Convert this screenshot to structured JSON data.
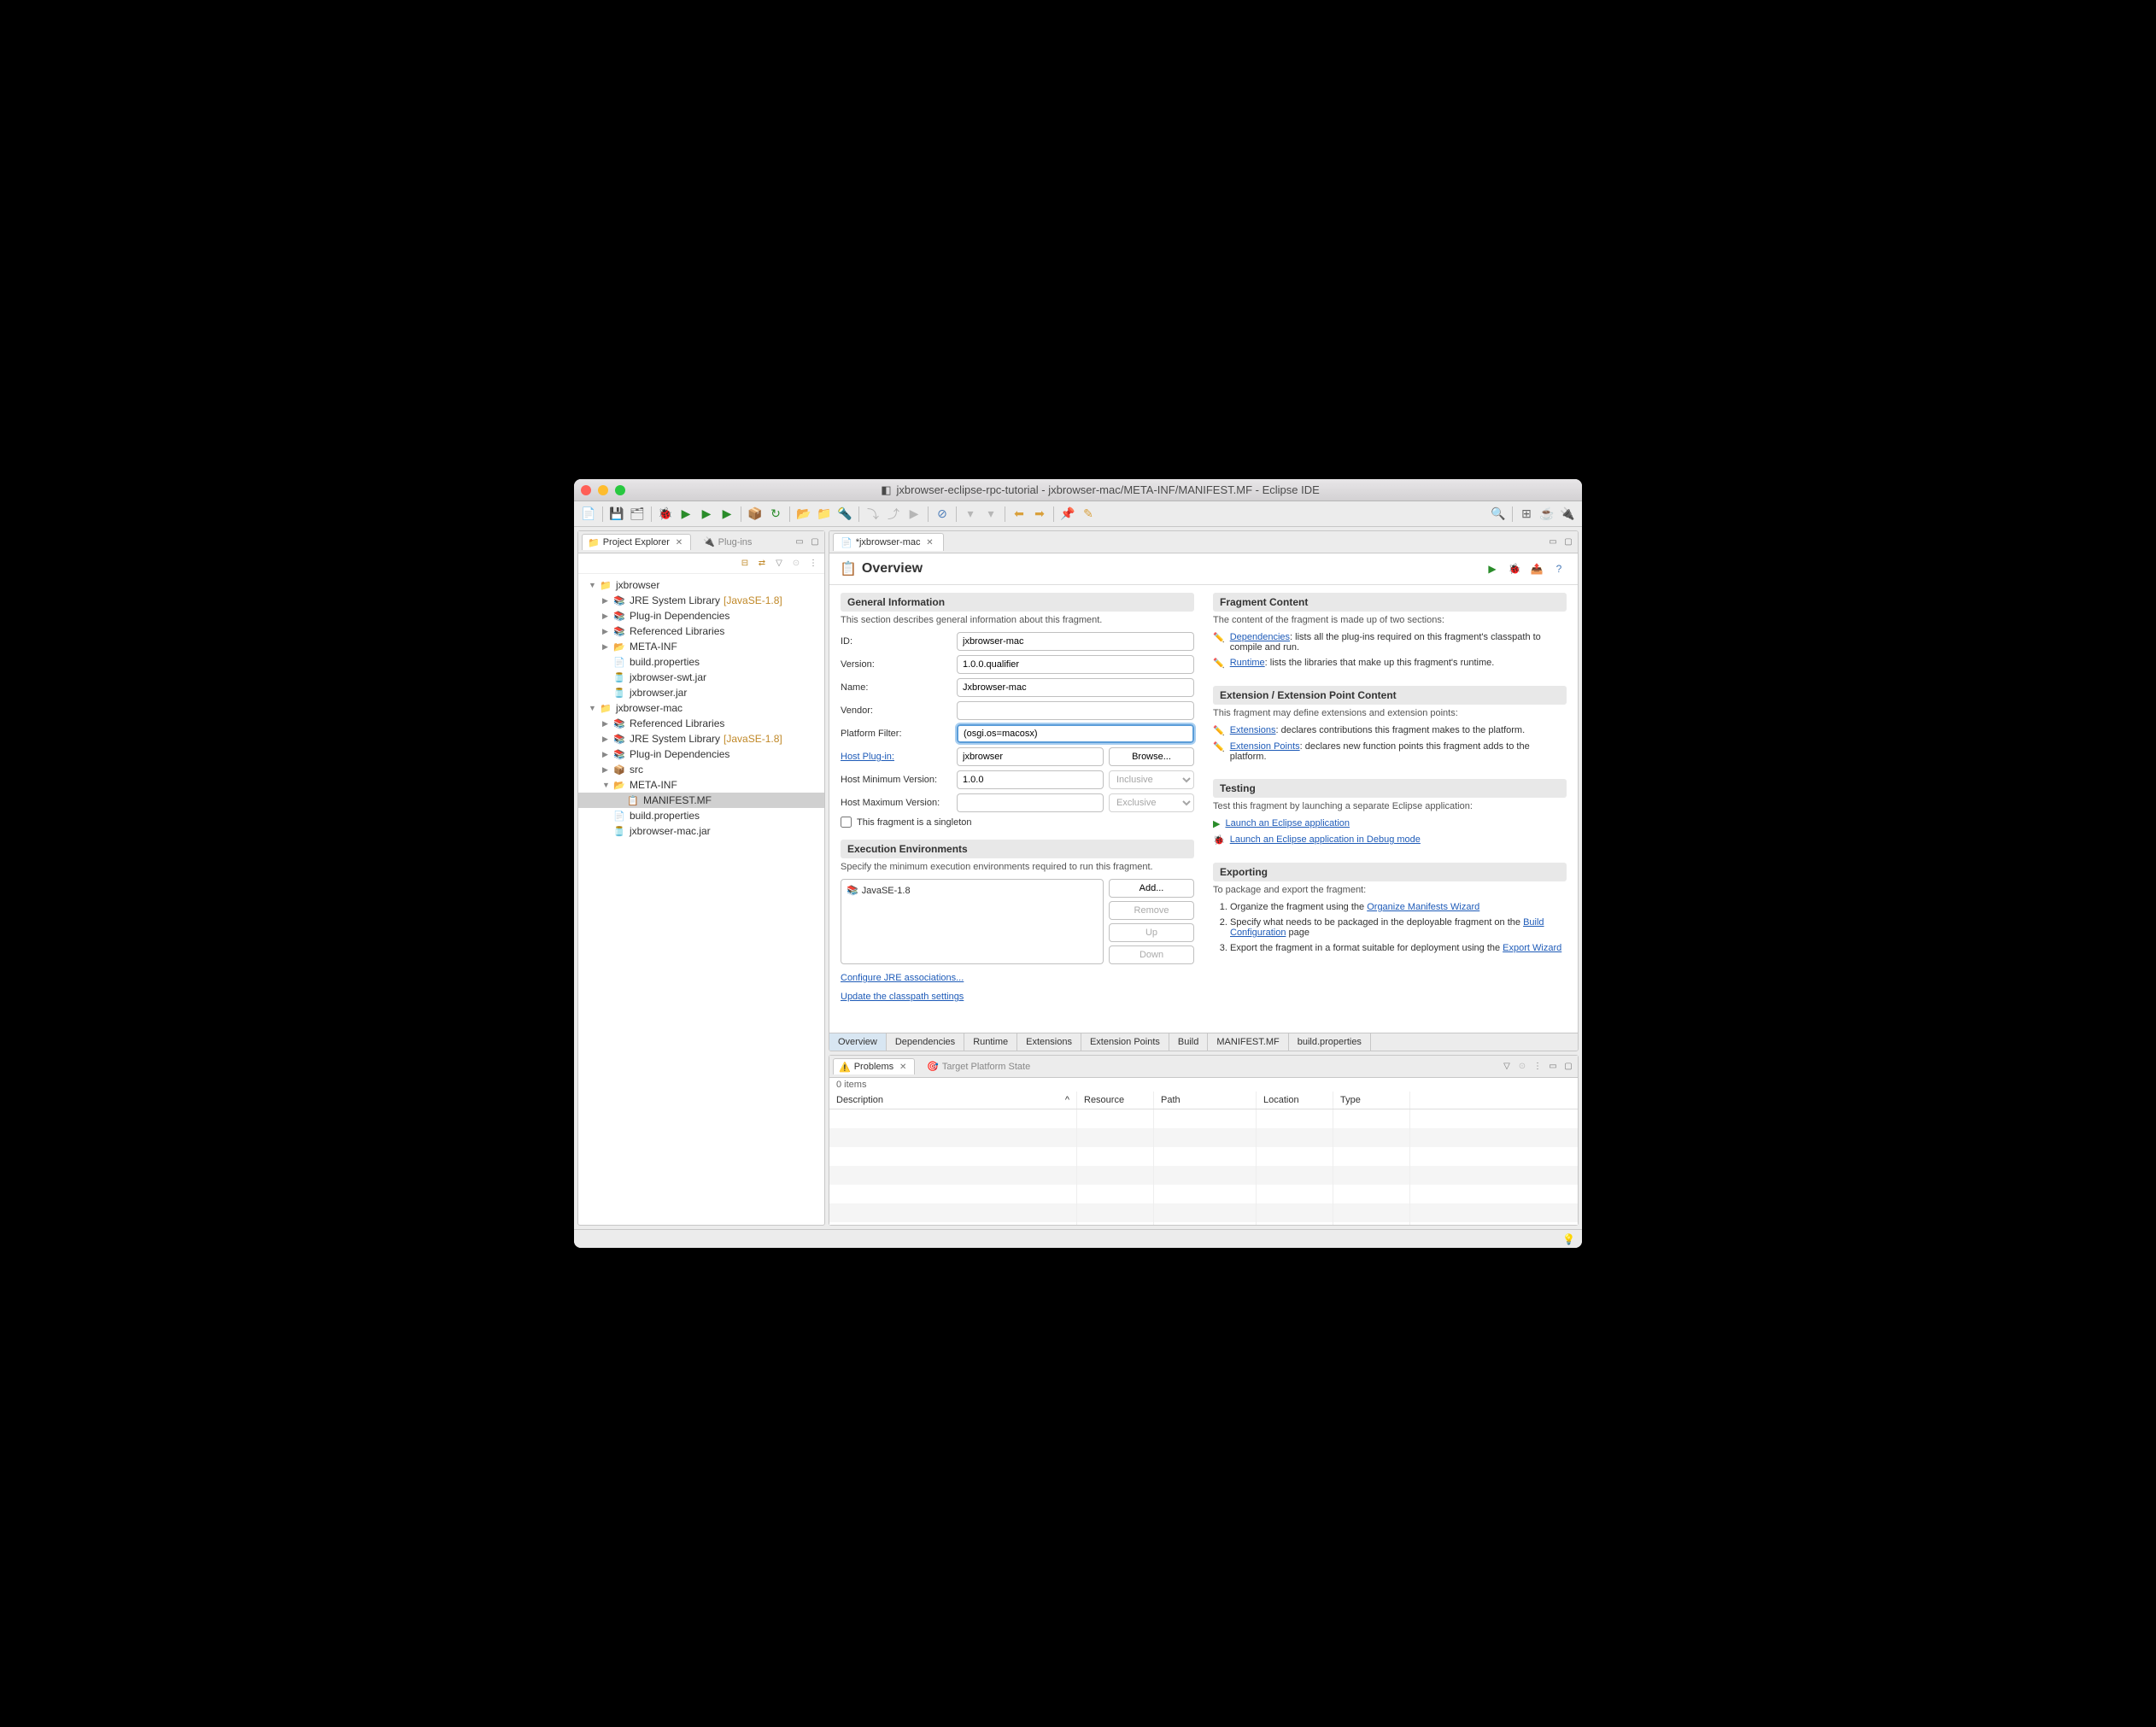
{
  "window": {
    "title": "jxbrowser-eclipse-rpc-tutorial - jxbrowser-mac/META-INF/MANIFEST.MF - Eclipse IDE"
  },
  "leftPanel": {
    "tabs": {
      "projectExplorer": "Project Explorer",
      "plugins": "Plug-ins"
    }
  },
  "tree": {
    "items": [
      {
        "label": "jxbrowser",
        "indent": 0,
        "arrow": "▼",
        "icon": "project"
      },
      {
        "label": "JRE System Library",
        "decoration": "[JavaSE-1.8]",
        "indent": 1,
        "arrow": "▶",
        "icon": "library"
      },
      {
        "label": "Plug-in Dependencies",
        "indent": 1,
        "arrow": "▶",
        "icon": "library"
      },
      {
        "label": "Referenced Libraries",
        "indent": 1,
        "arrow": "▶",
        "icon": "library"
      },
      {
        "label": "META-INF",
        "indent": 1,
        "arrow": "▶",
        "icon": "folder"
      },
      {
        "label": "build.properties",
        "indent": 1,
        "arrow": "",
        "icon": "props"
      },
      {
        "label": "jxbrowser-swt.jar",
        "indent": 1,
        "arrow": "",
        "icon": "jar"
      },
      {
        "label": "jxbrowser.jar",
        "indent": 1,
        "arrow": "",
        "icon": "jar"
      },
      {
        "label": "jxbrowser-mac",
        "indent": 0,
        "arrow": "▼",
        "icon": "project"
      },
      {
        "label": "Referenced Libraries",
        "indent": 1,
        "arrow": "▶",
        "icon": "library"
      },
      {
        "label": "JRE System Library",
        "decoration": "[JavaSE-1.8]",
        "indent": 1,
        "arrow": "▶",
        "icon": "library"
      },
      {
        "label": "Plug-in Dependencies",
        "indent": 1,
        "arrow": "▶",
        "icon": "library"
      },
      {
        "label": "src",
        "indent": 1,
        "arrow": "▶",
        "icon": "src"
      },
      {
        "label": "META-INF",
        "indent": 1,
        "arrow": "▼",
        "icon": "folder"
      },
      {
        "label": "MANIFEST.MF",
        "indent": 2,
        "arrow": "",
        "icon": "manifest",
        "selected": true
      },
      {
        "label": "build.properties",
        "indent": 1,
        "arrow": "",
        "icon": "props"
      },
      {
        "label": "jxbrowser-mac.jar",
        "indent": 1,
        "arrow": "",
        "icon": "jar"
      }
    ]
  },
  "editor": {
    "tabLabel": "*jxbrowser-mac",
    "title": "Overview"
  },
  "general": {
    "header": "General Information",
    "desc": "This section describes general information about this fragment.",
    "labels": {
      "id": "ID:",
      "version": "Version:",
      "name": "Name:",
      "vendor": "Vendor:",
      "platformFilter": "Platform Filter:",
      "hostPlugin": "Host Plug-in:",
      "hostMin": "Host Minimum Version:",
      "hostMax": "Host Maximum Version:"
    },
    "values": {
      "id": "jxbrowser-mac",
      "version": "1.0.0.qualifier",
      "name": "Jxbrowser-mac",
      "vendor": "",
      "platformFilter": "(osgi.os=macosx)",
      "hostPlugin": "jxbrowser",
      "hostMin": "1.0.0",
      "hostMax": ""
    },
    "browse": "Browse...",
    "inclusive": "Inclusive",
    "exclusive": "Exclusive",
    "singleton": "This fragment is a singleton"
  },
  "exec": {
    "header": "Execution Environments",
    "desc": "Specify the minimum execution environments required to run this fragment.",
    "item": "JavaSE-1.8",
    "buttons": {
      "add": "Add...",
      "remove": "Remove",
      "up": "Up",
      "down": "Down"
    },
    "links": {
      "configure": "Configure JRE associations...",
      "update": "Update the classpath settings"
    }
  },
  "fragmentContent": {
    "header": "Fragment Content",
    "desc": "The content of the fragment is made up of two sections:",
    "dependencies": "Dependencies",
    "dependenciesText": ": lists all the plug-ins required on this fragment's classpath to compile and run.",
    "runtime": "Runtime",
    "runtimeText": ": lists the libraries that make up this fragment's runtime."
  },
  "extensionContent": {
    "header": "Extension / Extension Point Content",
    "desc": "This fragment may define extensions and extension points:",
    "extensions": "Extensions",
    "extensionsText": ": declares contributions this fragment makes to the platform.",
    "extPoints": "Extension Points",
    "extPointsText": ": declares new function points this fragment adds to the platform."
  },
  "testing": {
    "header": "Testing",
    "desc": "Test this fragment by launching a separate Eclipse application:",
    "launch": "Launch an Eclipse application",
    "launchDebug": "Launch an Eclipse application in Debug mode"
  },
  "exporting": {
    "header": "Exporting",
    "desc": "To package and export the fragment:",
    "step1a": "Organize the fragment using the ",
    "step1link": "Organize Manifests Wizard",
    "step2a": "Specify what needs to be packaged in the deployable fragment on the ",
    "step2link": "Build Configuration",
    "step2b": " page",
    "step3a": "Export the fragment in a format suitable for deployment using the ",
    "step3link": "Export Wizard"
  },
  "bottomTabs": [
    "Overview",
    "Dependencies",
    "Runtime",
    "Extensions",
    "Extension Points",
    "Build",
    "MANIFEST.MF",
    "build.properties"
  ],
  "problems": {
    "tab1": "Problems",
    "tab2": "Target Platform State",
    "count": "0 items",
    "columns": {
      "description": "Description",
      "resource": "Resource",
      "path": "Path",
      "location": "Location",
      "type": "Type"
    }
  }
}
